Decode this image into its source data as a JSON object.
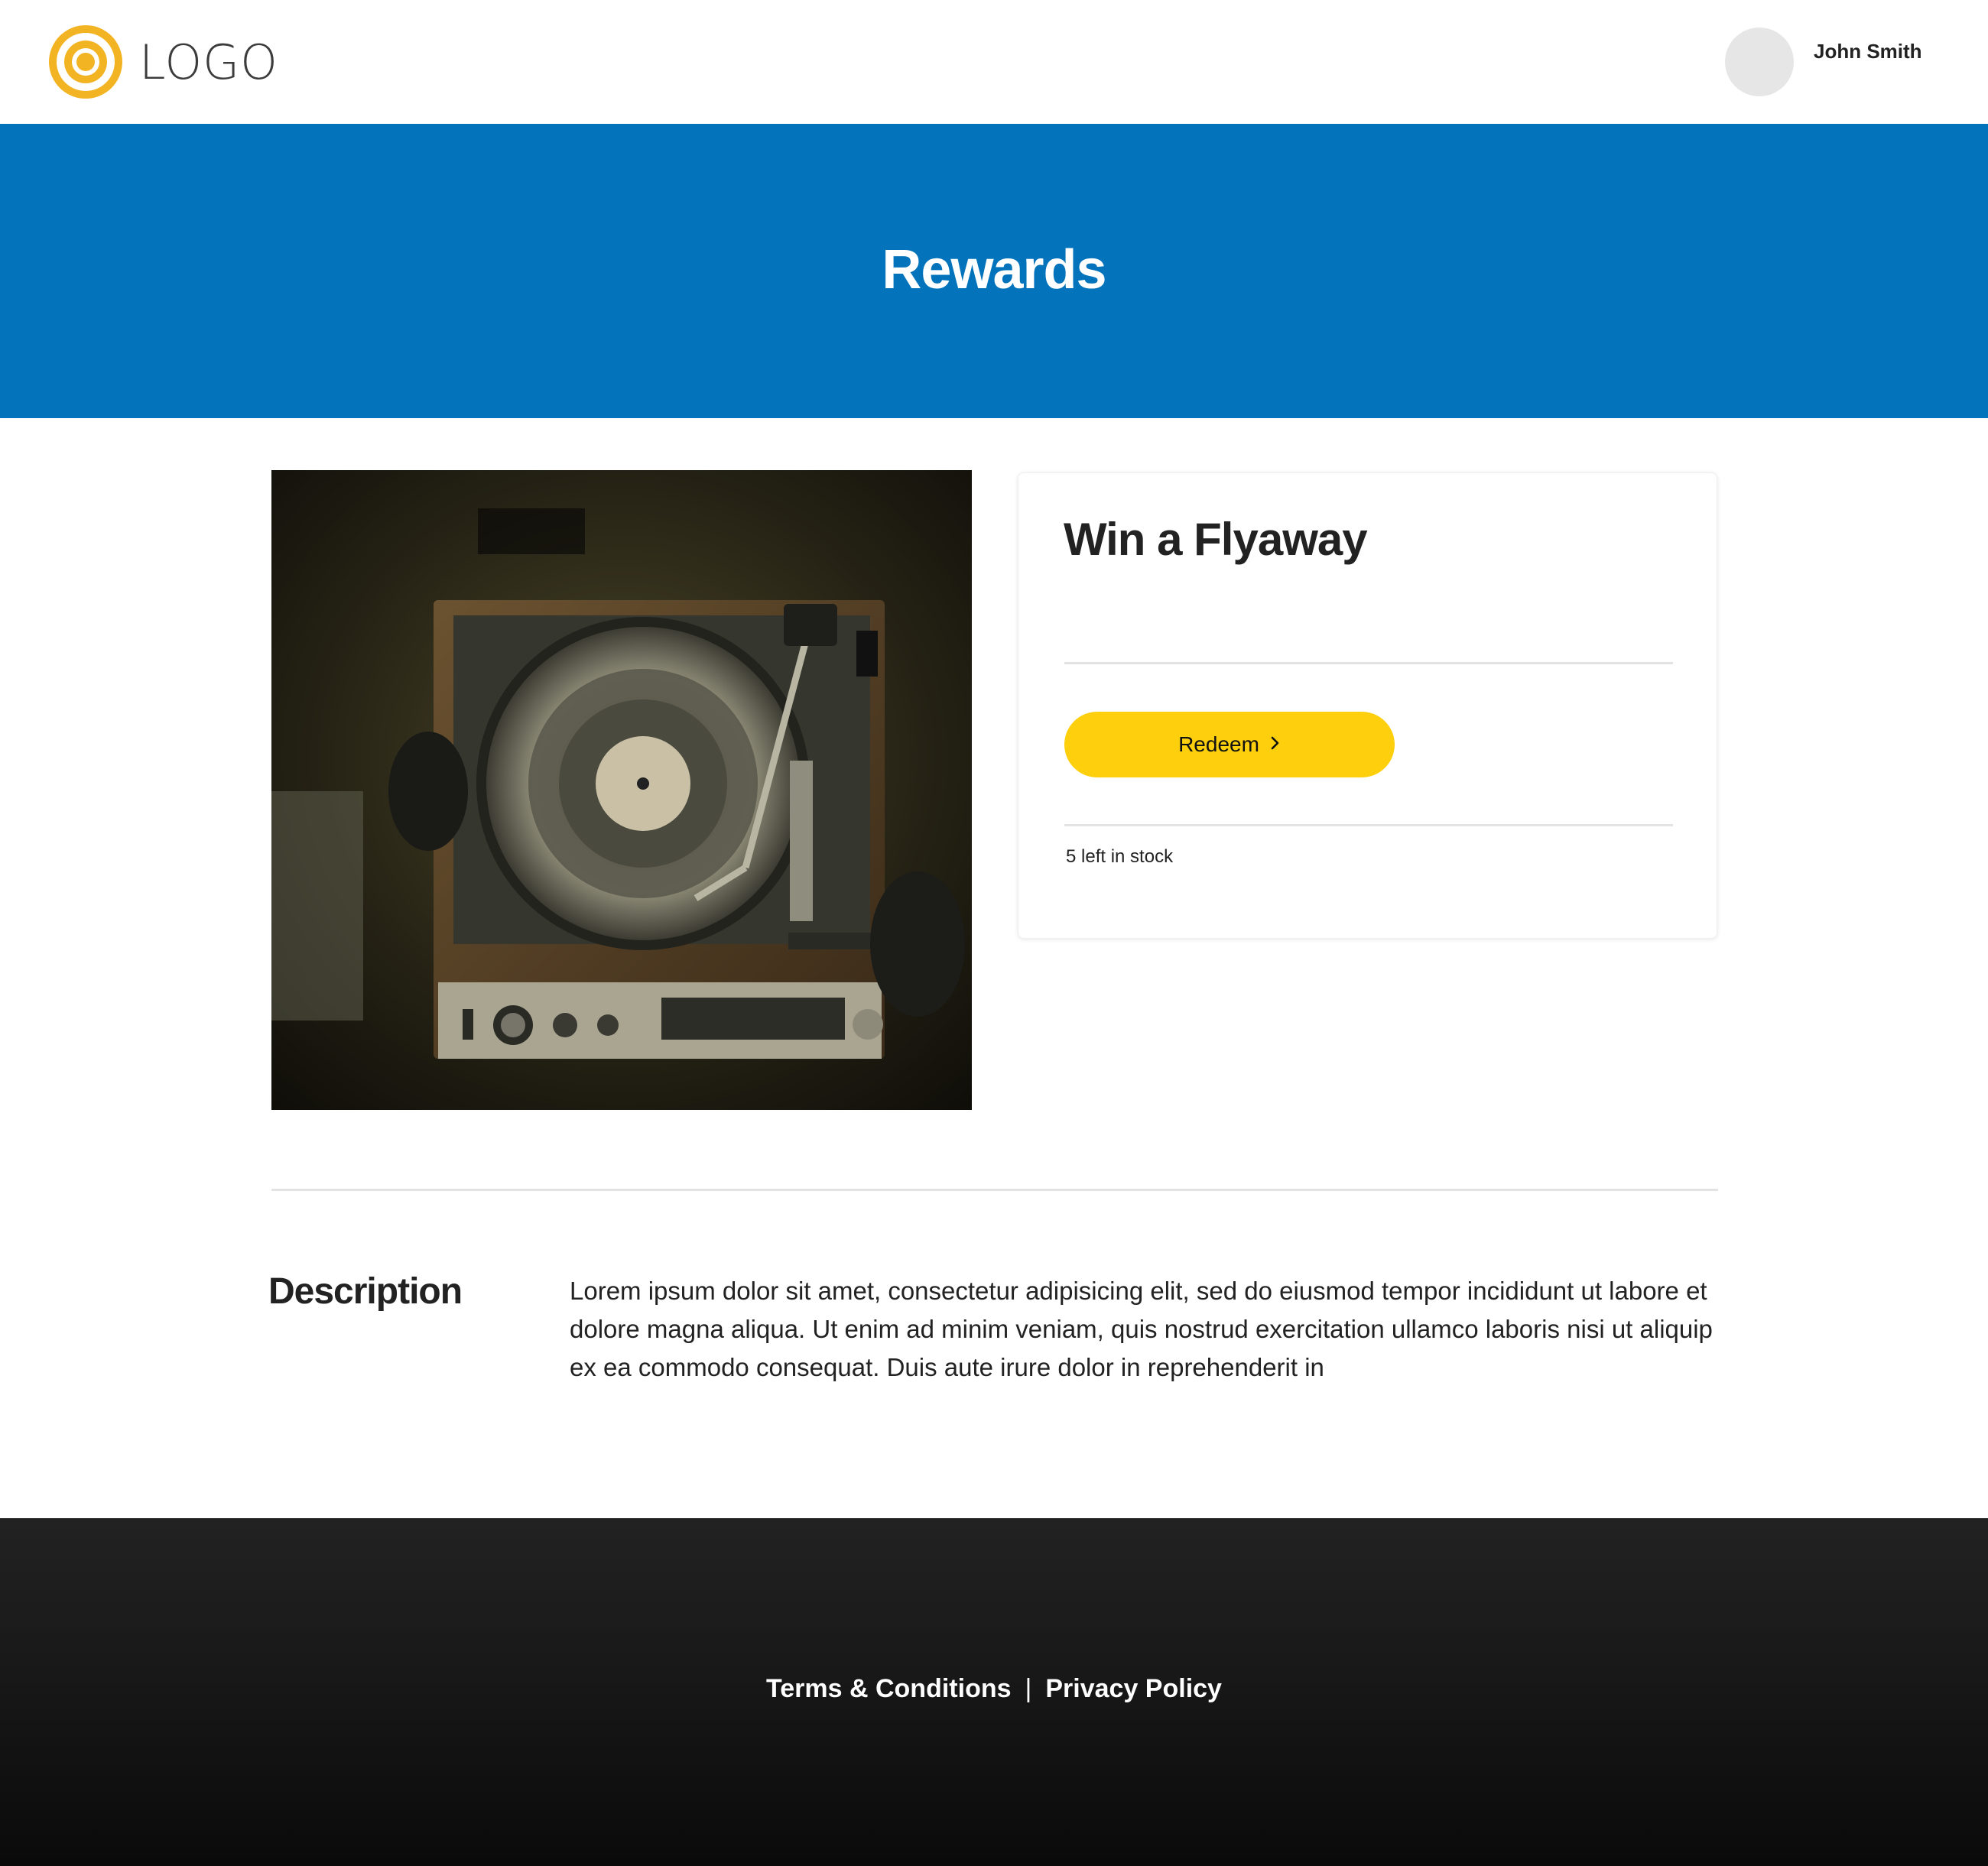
{
  "header": {
    "logo_text": "LOGO",
    "user_name": "John Smith",
    "colors": {
      "logo": "#f3b423"
    }
  },
  "hero": {
    "title": "Rewards",
    "background": "#0374bc"
  },
  "product": {
    "image_icon": "record-player-photo",
    "title": "Win a Flyaway",
    "redeem_label": "Redeem",
    "redeem_icon": "chevron-right-icon",
    "stock_text": "5 left in stock",
    "accent": "#fdcf0c"
  },
  "description": {
    "heading": "Description",
    "body": "Lorem ipsum dolor sit amet, consectetur adipisicing elit, sed do eiusmod tempor incididunt ut labore et dolore magna aliqua. Ut enim ad minim veniam, quis nostrud exercitation ullamco laboris nisi ut aliquip ex ea commodo consequat. Duis aute irure dolor in reprehenderit in"
  },
  "footer": {
    "links": [
      "Terms & Conditions",
      "Privacy Policy"
    ],
    "separator": "|"
  }
}
